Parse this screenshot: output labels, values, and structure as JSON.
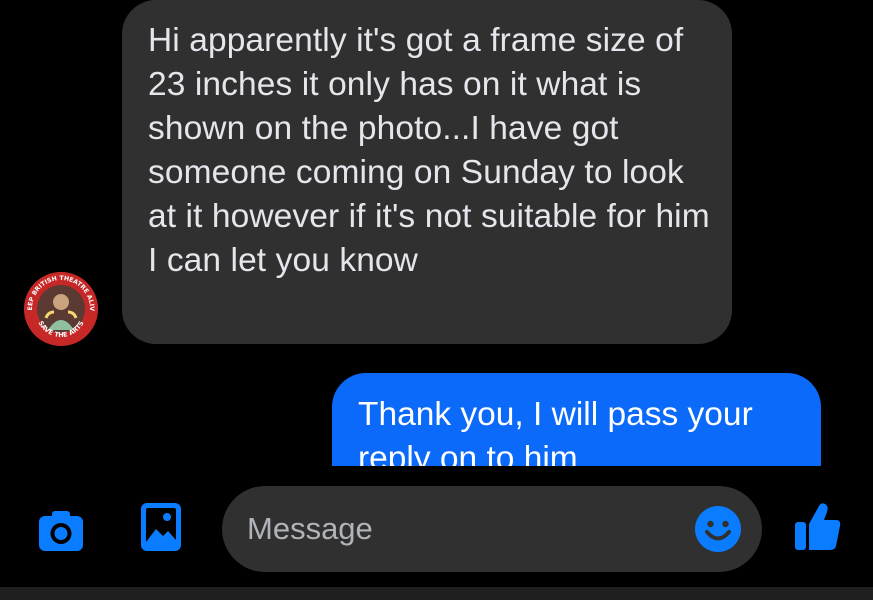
{
  "conversation": {
    "incoming_message": "Hi apparently it's got a frame size of 23 inches it only has on it what is shown on the photo...I have got someone coming on Sunday to look at it however if it's not suitable for him I can let you know",
    "outgoing_message": "Thank you, I will pass your reply on to him",
    "avatar": {
      "badge_text_top": "KEEP BRITISH THEATRE ALIVE",
      "badge_text_bottom": "SAVE THE ARTS"
    }
  },
  "composer": {
    "placeholder": "Message",
    "icons": [
      "camera-icon",
      "gallery-icon",
      "emoji-icon",
      "thumbs-up-icon"
    ]
  },
  "colors": {
    "background": "#000000",
    "incoming_bubble": "#303030",
    "outgoing_bubble": "#0b6af9",
    "accent": "#0a7cff",
    "placeholder_text": "#b0b3b8"
  }
}
